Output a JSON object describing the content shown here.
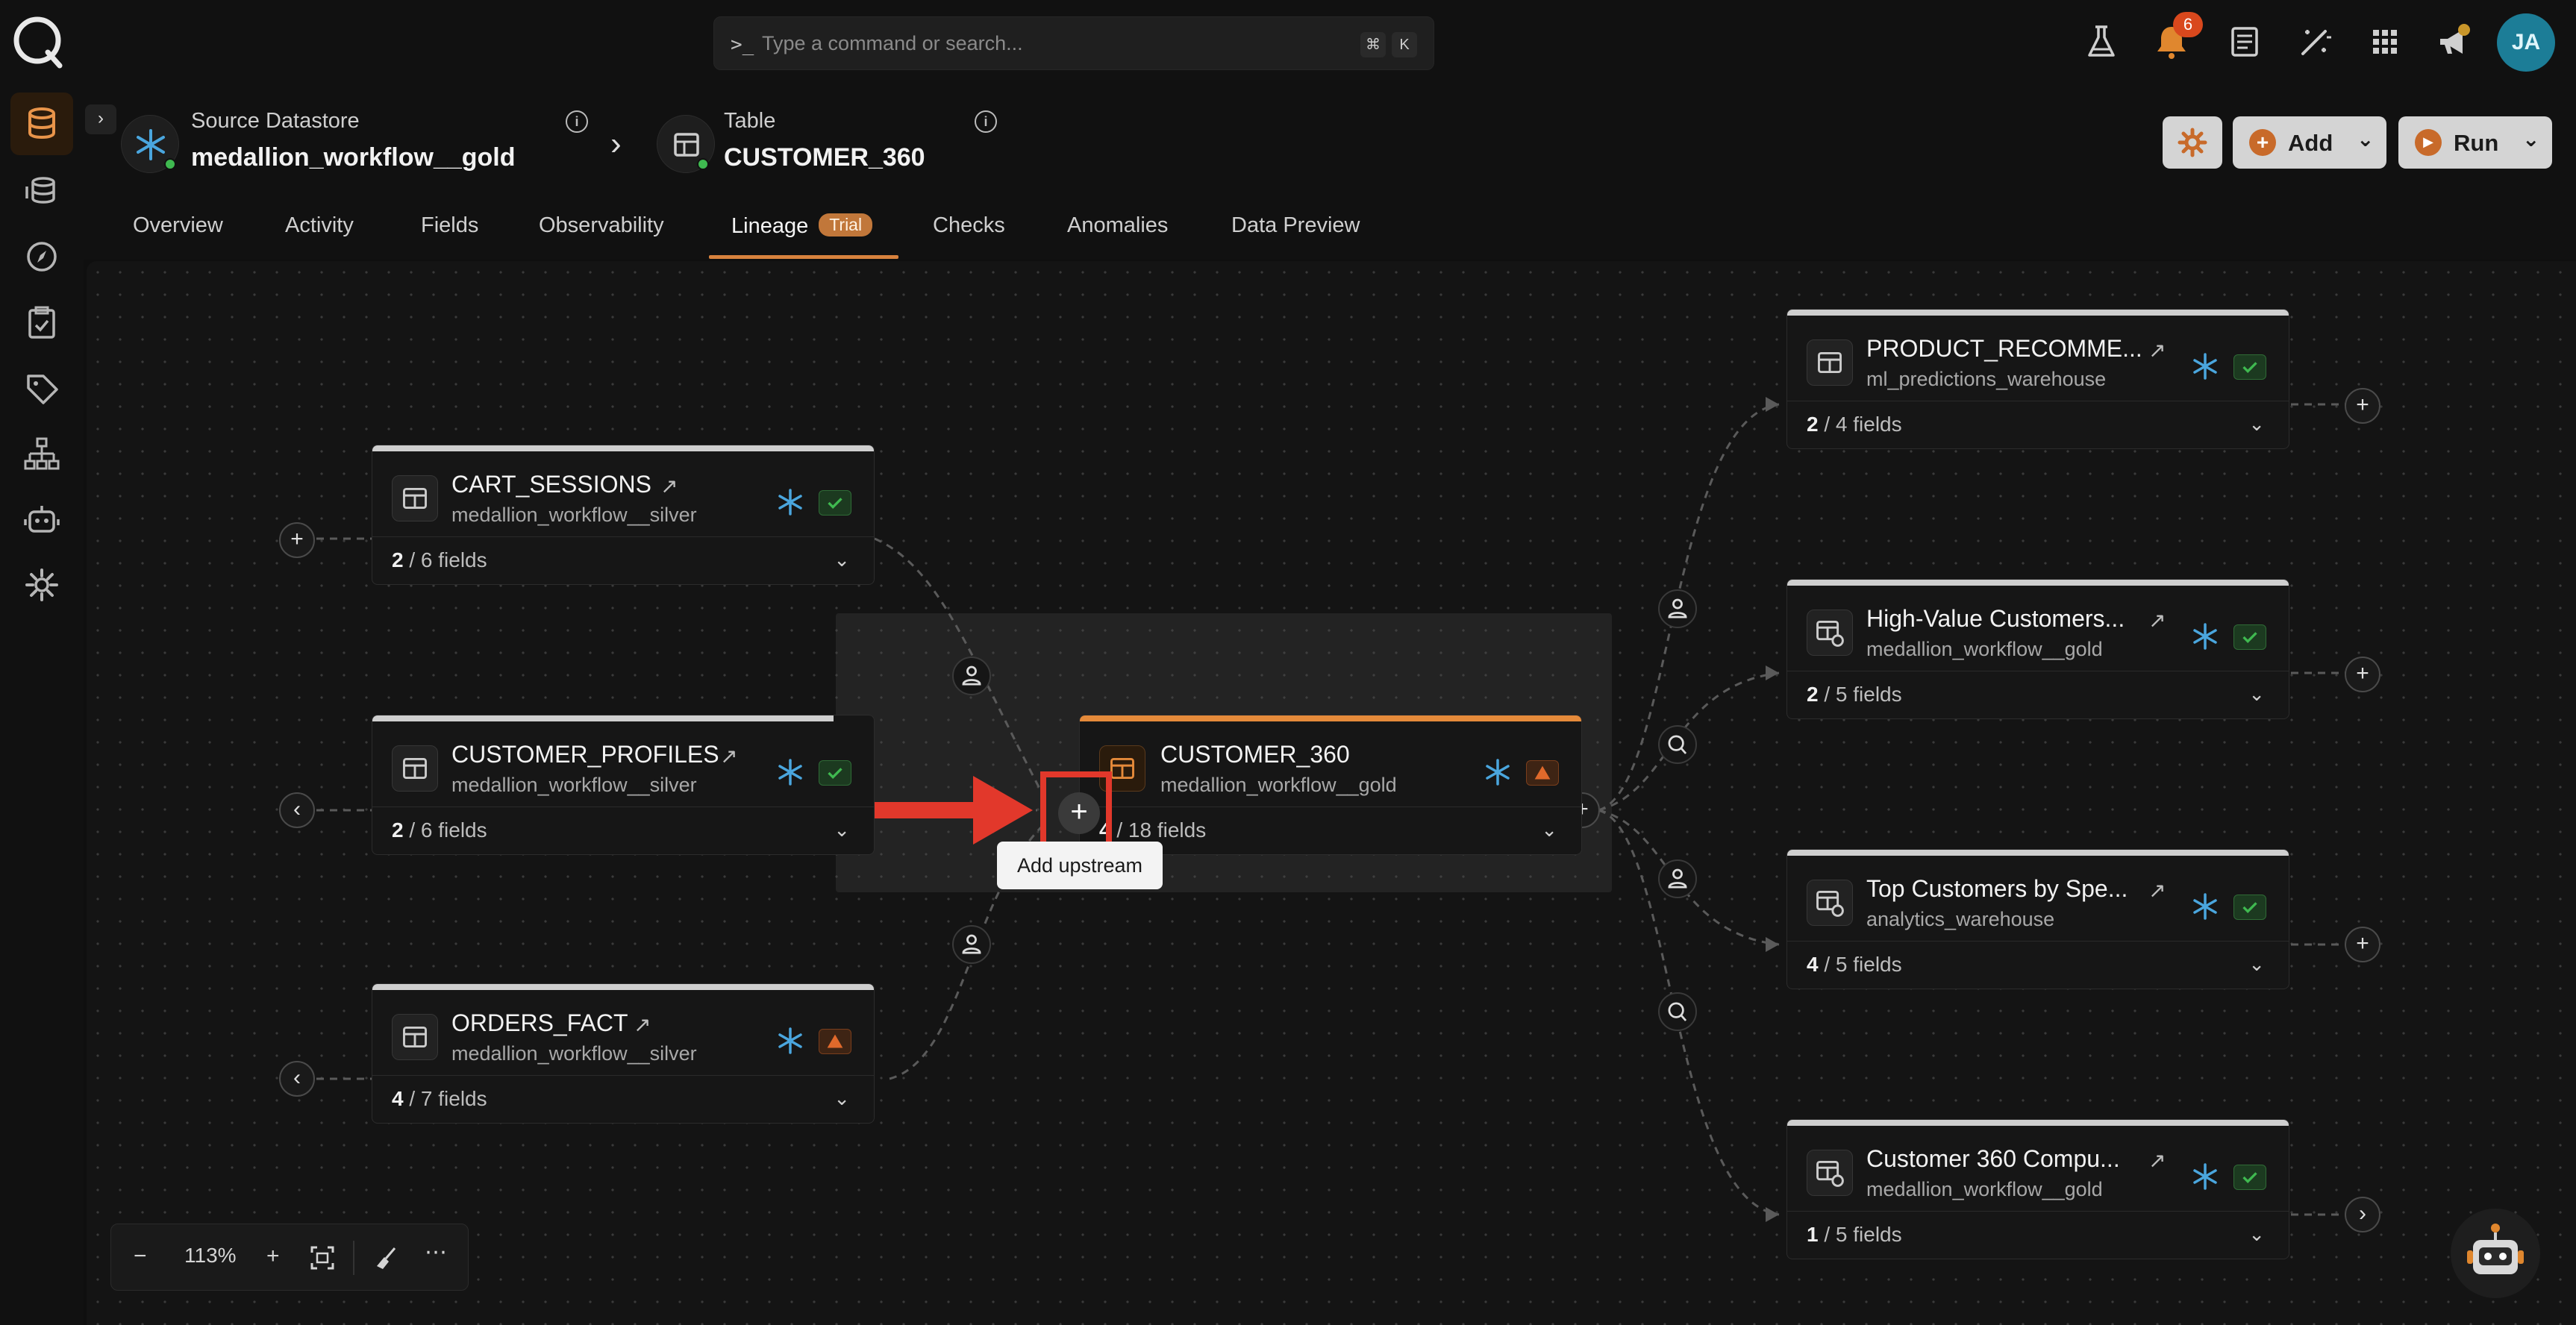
{
  "command_bar": {
    "placeholder": "Type a command or search...",
    "key1": "⌘",
    "key2": "K"
  },
  "notifications": {
    "count": "6"
  },
  "user": {
    "initials": "JA"
  },
  "header": {
    "source_label": "Source Datastore",
    "source_name": "medallion_workflow__gold",
    "table_label": "Table",
    "table_name": "CUSTOMER_360",
    "settings_label": "",
    "add_label": "Add",
    "run_label": "Run"
  },
  "tabs": [
    "Overview",
    "Activity",
    "Fields",
    "Observability",
    "Lineage",
    "Checks",
    "Anomalies",
    "Data Preview"
  ],
  "trial_badge": "Trial",
  "nodes": {
    "cart_sessions": {
      "title": "CART_SESSIONS",
      "sub": "medallion_workflow__silver",
      "fields_sel": "2",
      "fields_total": " / 6 fields",
      "status": "ok"
    },
    "customer_profiles": {
      "title": "CUSTOMER_PROFILES",
      "sub": "medallion_workflow__silver",
      "fields_sel": "2",
      "fields_total": " / 6 fields",
      "status": "ok"
    },
    "orders_fact": {
      "title": "ORDERS_FACT",
      "sub": "medallion_workflow__silver",
      "fields_sel": "4",
      "fields_total": " / 7 fields",
      "status": "warn"
    },
    "customer_360": {
      "title": "CUSTOMER_360",
      "sub": "medallion_workflow__gold",
      "fields_sel": "4",
      "fields_total": " / 18 fields",
      "status": "warn"
    },
    "product_recomme": {
      "title": "PRODUCT_RECOMME...",
      "sub": "ml_predictions_warehouse",
      "fields_sel": "2",
      "fields_total": " / 4 fields",
      "status": "ok"
    },
    "high_value": {
      "title": "High-Value Customers...",
      "sub": "medallion_workflow__gold",
      "fields_sel": "2",
      "fields_total": " / 5 fields",
      "status": "ok"
    },
    "top_customers": {
      "title": "Top Customers by Spe...",
      "sub": "analytics_warehouse",
      "fields_sel": "4",
      "fields_total": " / 5 fields",
      "status": "ok"
    },
    "customer_360_compu": {
      "title": "Customer 360 Compu...",
      "sub": "medallion_workflow__gold",
      "fields_sel": "1",
      "fields_total": " / 5 fields",
      "status": "ok"
    }
  },
  "tooltip": "Add upstream",
  "zoom": {
    "level": "113%"
  },
  "colors": {
    "accent": "#d8823d",
    "snowflake": "#4aa6de",
    "ok": "#3fb950",
    "warn": "#e0692b",
    "annotation": "#e2382b"
  }
}
